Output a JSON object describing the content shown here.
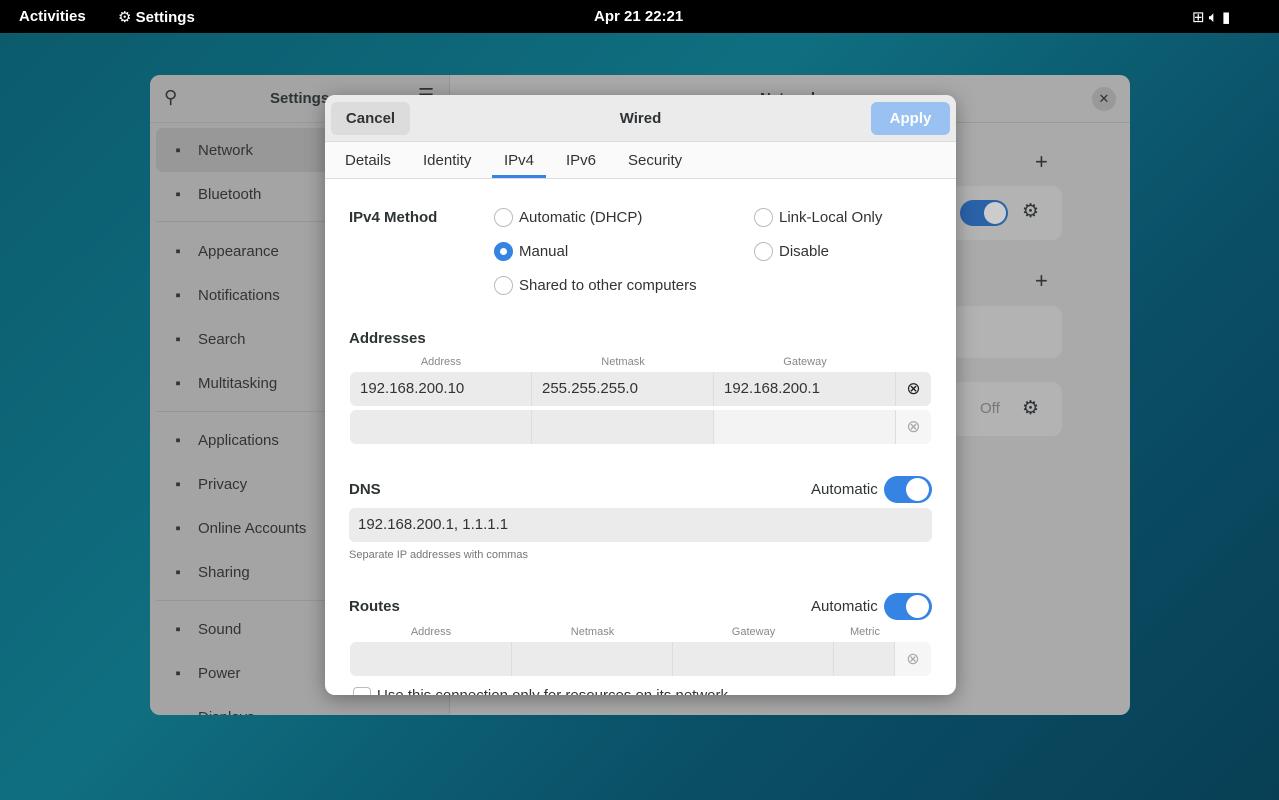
{
  "topbar": {
    "activities": "Activities",
    "app": "Settings",
    "clock": "Apr 21  22:21"
  },
  "settings": {
    "title": "Settings",
    "main_title": "Network",
    "off_label": "Off",
    "sidebar": [
      {
        "label": "Network",
        "icon": "network-icon"
      },
      {
        "label": "Bluetooth",
        "icon": "bluetooth-icon"
      },
      {
        "label": "Appearance",
        "icon": "appearance-icon"
      },
      {
        "label": "Notifications",
        "icon": "bell-icon"
      },
      {
        "label": "Search",
        "icon": "search-icon"
      },
      {
        "label": "Multitasking",
        "icon": "multitasking-icon"
      },
      {
        "label": "Applications",
        "icon": "grid-icon"
      },
      {
        "label": "Privacy",
        "icon": "hand-icon"
      },
      {
        "label": "Online Accounts",
        "icon": "at-icon"
      },
      {
        "label": "Sharing",
        "icon": "share-icon"
      },
      {
        "label": "Sound",
        "icon": "speaker-icon"
      },
      {
        "label": "Power",
        "icon": "power-icon"
      },
      {
        "label": "Displays",
        "icon": "display-icon"
      }
    ]
  },
  "dialog": {
    "cancel": "Cancel",
    "title": "Wired",
    "apply": "Apply",
    "tabs": [
      "Details",
      "Identity",
      "IPv4",
      "IPv6",
      "Security"
    ],
    "active_tab": "IPv4",
    "method_label": "IPv4 Method",
    "methods": [
      {
        "label": "Automatic (DHCP)",
        "selected": false
      },
      {
        "label": "Manual",
        "selected": true
      },
      {
        "label": "Shared to other computers",
        "selected": false
      },
      {
        "label": "Link-Local Only",
        "selected": false
      },
      {
        "label": "Disable",
        "selected": false
      }
    ],
    "addresses": {
      "label": "Addresses",
      "headers": [
        "Address",
        "Netmask",
        "Gateway"
      ],
      "rows": [
        [
          "192.168.200.10",
          "255.255.255.0",
          "192.168.200.1"
        ],
        [
          "",
          "",
          ""
        ]
      ]
    },
    "dns": {
      "label": "DNS",
      "auto_label": "Automatic",
      "auto": true,
      "value": "192.168.200.1, 1.1.1.1",
      "hint": "Separate IP addresses with commas"
    },
    "routes": {
      "label": "Routes",
      "auto_label": "Automatic",
      "auto": true,
      "headers": [
        "Address",
        "Netmask",
        "Gateway",
        "Metric"
      ]
    },
    "only_resources": "Use this connection only for resources on its network"
  },
  "accent": "#3584e4"
}
